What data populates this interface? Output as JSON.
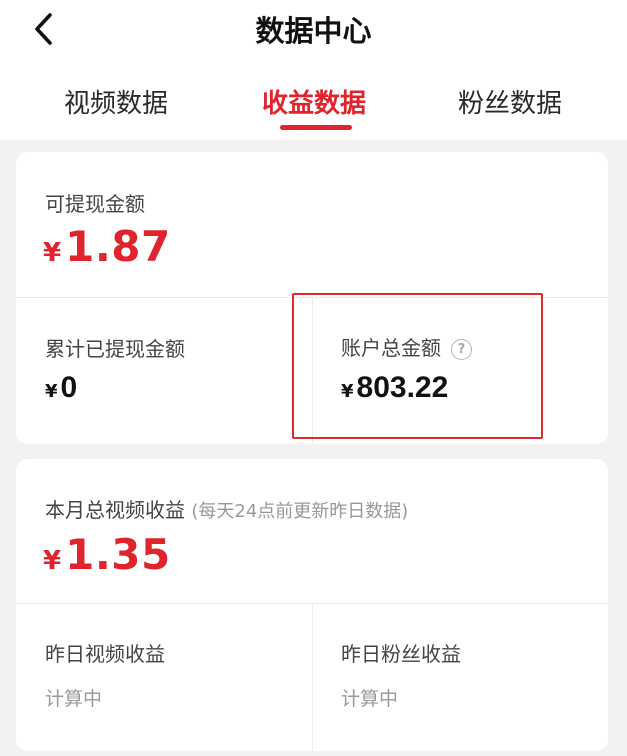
{
  "header": {
    "title": "数据中心",
    "back_icon": "chevron-left-icon"
  },
  "tabs": [
    {
      "label": "视频数据",
      "active": false
    },
    {
      "label": "收益数据",
      "active": true
    },
    {
      "label": "粉丝数据",
      "active": false
    }
  ],
  "balance_card": {
    "withdrawable": {
      "label": "可提现金额",
      "currency": "¥",
      "amount": "1.87"
    },
    "total_withdrawn": {
      "label": "累计已提现金额",
      "currency": "¥",
      "amount": "0"
    },
    "account_total": {
      "label": "账户总金额",
      "currency": "¥",
      "amount": "803.22",
      "help_glyph": "?"
    }
  },
  "monthly_card": {
    "label": "本月总视频收益",
    "note": "(每天24点前更新昨日数据)",
    "currency": "¥",
    "amount": "1.35",
    "yesterday_video": {
      "label": "昨日视频收益",
      "value": "计算中"
    },
    "yesterday_fans": {
      "label": "昨日粉丝收益",
      "value": "计算中"
    }
  },
  "colors": {
    "accent": "#e0232c",
    "highlight_box": "#e02a2a",
    "background": "#f2f2f2"
  }
}
